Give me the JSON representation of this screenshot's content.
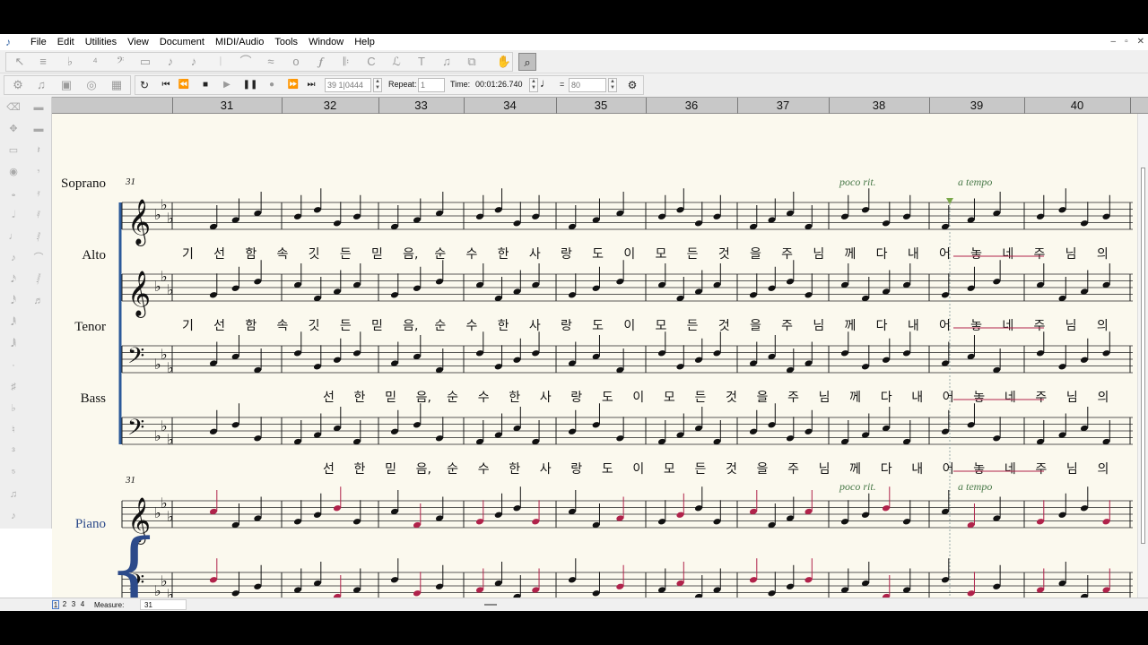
{
  "menubar": {
    "items": [
      "File",
      "Edit",
      "Utilities",
      "View",
      "Document",
      "MIDI/Audio",
      "Tools",
      "Window",
      "Help"
    ],
    "window_controls": [
      "–",
      "▫",
      "✕"
    ]
  },
  "playback": {
    "measure_beat": "39",
    "beat_tick": "1|0444",
    "repeat_label": "Repeat:",
    "repeat_value": "1",
    "time_label": "Time:",
    "time_value": "00:01:26.740",
    "tempo_equals": "=",
    "tempo_value": "80"
  },
  "ruler": {
    "measures": [
      "31",
      "32",
      "33",
      "34",
      "35",
      "36",
      "37",
      "38",
      "39",
      "40"
    ]
  },
  "score": {
    "system_measure_number": "31",
    "piano_measure_number": "31",
    "staves": [
      "Soprano",
      "Alto",
      "Tenor",
      "Bass",
      "Piano"
    ],
    "expressions": {
      "poco_rit": "poco rit.",
      "a_tempo": "a tempo"
    },
    "lyrics_upper": [
      "기",
      "선",
      "함",
      "속",
      "깃",
      "든",
      "믿",
      "음,",
      "순",
      "수",
      "한",
      "사",
      "랑",
      "도",
      "이",
      "모",
      "든",
      "것",
      "을",
      "주",
      "님",
      "께",
      "다",
      "내",
      "어",
      "놓",
      "네",
      "주",
      "님",
      "의"
    ],
    "lyrics_lower": [
      "선",
      "한",
      "믿",
      "음,",
      "순",
      "수",
      "한",
      "사",
      "랑",
      "도",
      "이",
      "모",
      "든",
      "것",
      "을",
      "주",
      "님",
      "께",
      "다",
      "내",
      "어",
      "놓",
      "네",
      "주",
      "님",
      "의"
    ]
  },
  "statusbar": {
    "pages": [
      "1",
      "2",
      "3",
      "4"
    ],
    "measure_label": "Measure:",
    "measure_value": "31"
  },
  "colors": {
    "ruler_bg": "#c8c8c8",
    "score_paper": "#fbf9ee",
    "cue_notes": "#b0224a",
    "lyric_extender": "#b0224a",
    "expression_green": "#4a7a4a",
    "piano_label": "#2c4a8a",
    "highlight_yellow": "#c8a020"
  }
}
